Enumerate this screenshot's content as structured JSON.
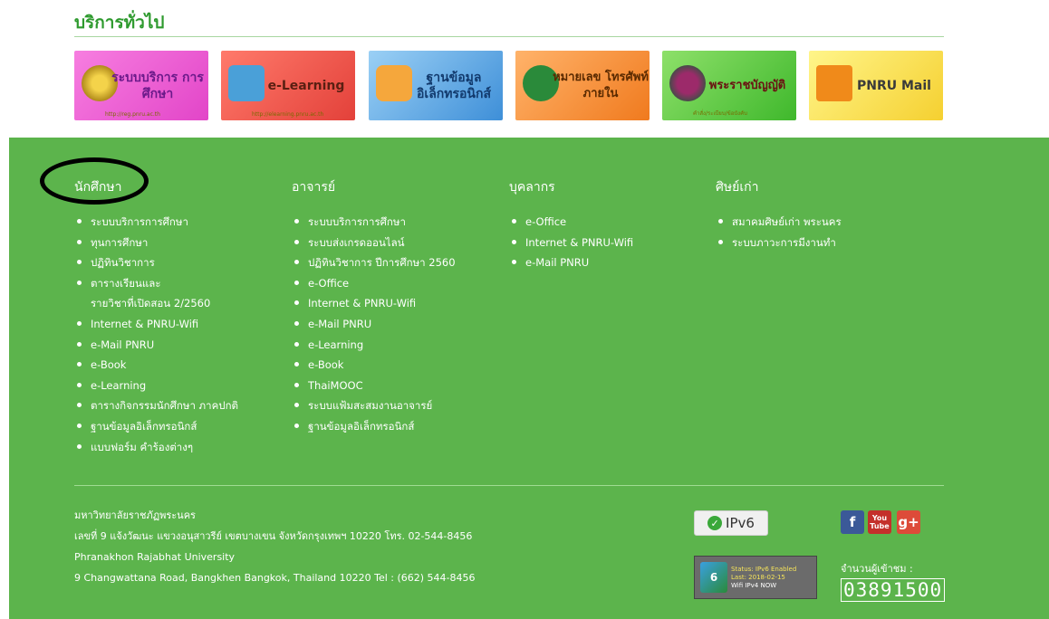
{
  "services": {
    "title": "บริการทั่วไป",
    "banners": [
      {
        "label": "ระบบบริการ การศึกษา",
        "sub": "http://reg.pnru.ac.th"
      },
      {
        "label": "e-Learning",
        "sub": "http://elearning.pnru.ac.th"
      },
      {
        "label": "ฐานข้อมูล อิเล็กทรอนิกส์",
        "sub": ""
      },
      {
        "label": "หมายเลข โทรศัพท์ภายใน",
        "sub": ""
      },
      {
        "label": "พระราชบัญญัติ",
        "sub": "คำสั่ง/ระเบียบ/ข้อบังคับ"
      },
      {
        "label": "PNRU Mail",
        "sub": ""
      }
    ]
  },
  "footer": {
    "columns": [
      {
        "heading": "นักศึกษา",
        "items": [
          "ระบบบริการการศึกษา",
          "ทุนการศึกษา",
          "ปฏิทินวิชาการ",
          "ตารางเรียนและ",
          "Internet & PNRU-Wifi",
          "e-Mail PNRU",
          "e-Book",
          "e-Learning",
          "ตารางกิจกรรมนักศึกษา ภาคปกติ",
          "ฐานข้อมูลอิเล็กทรอนิกส์",
          "แบบฟอร์ม คำร้องต่างๆ"
        ],
        "item_line2": "รายวิชาที่เปิดสอน 2/2560"
      },
      {
        "heading": "อาจารย์",
        "items": [
          "ระบบบริการการศึกษา",
          "ระบบส่งเกรดออนไลน์",
          "ปฏิทินวิชาการ ปีการศึกษา 2560",
          "e-Office",
          "Internet & PNRU-Wifi",
          "e-Mail PNRU",
          "e-Learning",
          "e-Book",
          "ThaiMOOC",
          "ระบบแฟ้มสะสมงานอาจารย์",
          "ฐานข้อมูลอิเล็กทรอนิกส์"
        ]
      },
      {
        "heading": "บุคลากร",
        "items": [
          "e-Office",
          "Internet & PNRU-Wifi",
          "e-Mail PNRU"
        ]
      },
      {
        "heading": "ศิษย์เก่า",
        "items": [
          "สมาคมศิษย์เก่า พระนคร",
          "ระบบภาวะการมีงานทำ"
        ]
      }
    ],
    "address": {
      "line1": "มหาวิทยาลัยราชภัฏพระนคร",
      "line2": "เลขที่ 9 แจ้งวัฒนะ แขวงอนุสาวรีย์ เขตบางเขน จังหวัดกรุงเทพฯ 10220 โทร. 02-544-8456",
      "line3": "Phranakhon Rajabhat University",
      "line4": "9 Changwattana Road, Bangkhen Bangkok, Thailand 10220 Tel : (662) 544-8456"
    },
    "ipv6_label": "IPv6",
    "social": {
      "facebook": "f",
      "youtube": "You Tube",
      "gplus": "g+"
    },
    "status_box": {
      "status": "Status: IPv6 Enabled",
      "last": "Last: 2018-02-15",
      "note": "Wifi IPv4 NOW",
      "logo": "6"
    },
    "visitor_label": "จำนวนผู้เข้าชม :",
    "visitor_count": "03891500"
  }
}
